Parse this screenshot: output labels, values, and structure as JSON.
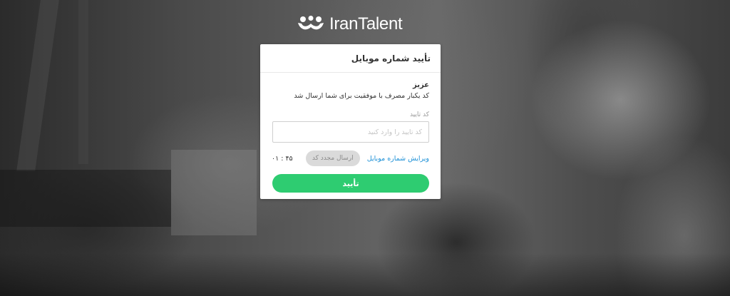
{
  "brand": {
    "name": "IranTalent"
  },
  "card": {
    "title": "تأیید شماره موبایل",
    "greeting": "عزیز",
    "message": "کد یکبار مصرف با موفقیت برای شما ارسال شد",
    "code_field": {
      "label": "کد تایید",
      "placeholder": "کد تایید را وارد کنید",
      "value": ""
    },
    "edit_phone_link": "ویرایش شماره موبایل",
    "resend_button": "ارسال مجدد کد",
    "timer": "۰۱ : ۴۵",
    "confirm_button": "تأیید"
  },
  "colors": {
    "accent_green": "#2ecc71",
    "link_blue": "#1a8fd6",
    "disabled_gray": "#dadada"
  }
}
